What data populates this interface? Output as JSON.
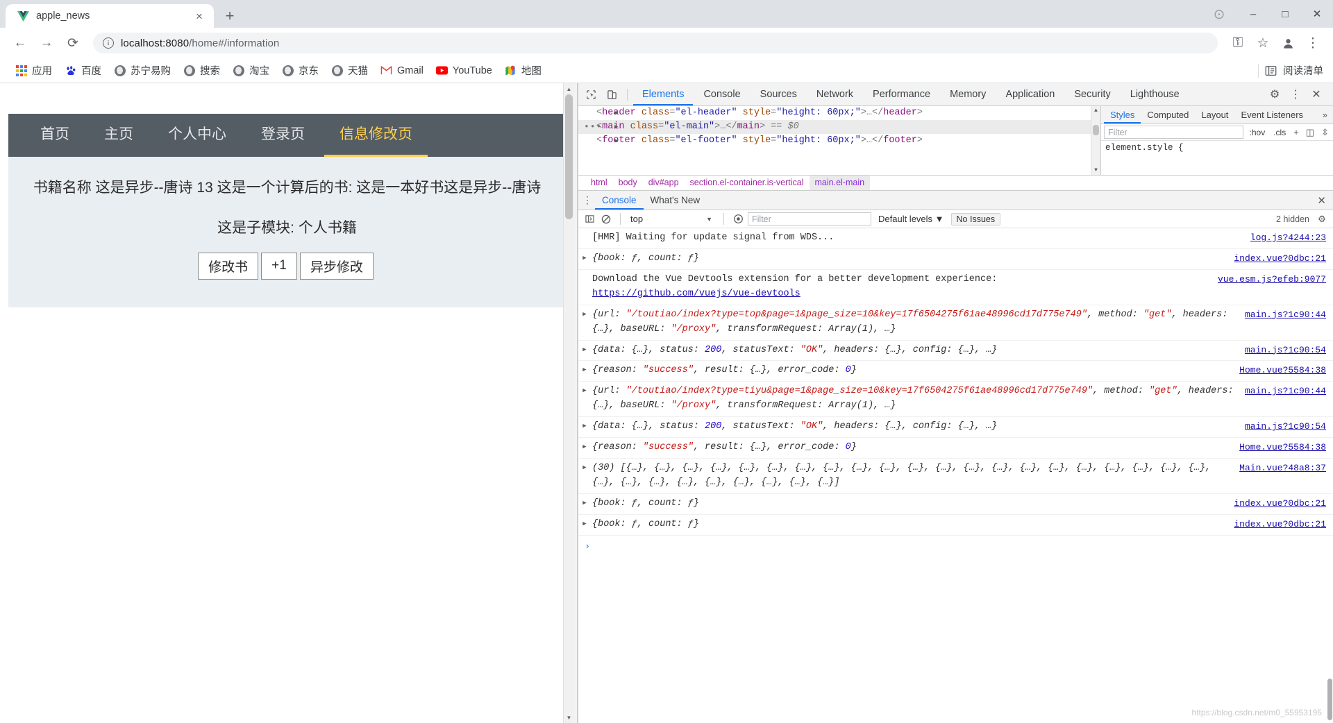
{
  "browser": {
    "tab": {
      "title": "apple_news",
      "favicon": "vue-logo-icon",
      "close": "×"
    },
    "new_tab": "+",
    "window_controls": {
      "minimize": "–",
      "maximize": "□",
      "close": "✕",
      "extra": "⊙"
    },
    "toolbar": {
      "back": "←",
      "forward": "→",
      "reload": "⟳",
      "url_secure_icon": "i",
      "url_host": "localhost:8080",
      "url_path": "/home#/information",
      "full_url": "localhost:8080/home#/information",
      "key_icon": "⚿",
      "star_icon": "☆",
      "profile_icon": "person-icon",
      "menu_icon": "⋮"
    },
    "bookmarks": [
      {
        "label": "应用",
        "icon": "apps-grid-icon"
      },
      {
        "label": "百度",
        "icon": "baidu-icon"
      },
      {
        "label": "苏宁易购",
        "icon": "globe-icon"
      },
      {
        "label": "搜索",
        "icon": "globe-icon"
      },
      {
        "label": "淘宝",
        "icon": "globe-icon"
      },
      {
        "label": "京东",
        "icon": "globe-icon"
      },
      {
        "label": "天猫",
        "icon": "globe-icon"
      },
      {
        "label": "Gmail",
        "icon": "gmail-icon"
      },
      {
        "label": "YouTube",
        "icon": "youtube-icon"
      },
      {
        "label": "地图",
        "icon": "maps-icon"
      }
    ],
    "reading_list": {
      "label": "阅读清单",
      "icon": "reading-list-icon"
    }
  },
  "app": {
    "nav": [
      {
        "label": "首页",
        "active": false
      },
      {
        "label": "主页",
        "active": false
      },
      {
        "label": "个人中心",
        "active": false
      },
      {
        "label": "登录页",
        "active": false
      },
      {
        "label": "信息修改页",
        "active": true
      }
    ],
    "book_line": "书籍名称 这是异步--唐诗 13 这是一个计算后的书: 这是一本好书这是异步--唐诗",
    "sub_line": "这是子模块: 个人书籍",
    "buttons": [
      {
        "label": "修改书"
      },
      {
        "label": "+1"
      },
      {
        "label": "异步修改"
      }
    ]
  },
  "devtools": {
    "tools": {
      "inspect": "inspect-icon",
      "device": "device-toolbar-icon"
    },
    "tabs": [
      {
        "label": "Elements",
        "active": true
      },
      {
        "label": "Console",
        "active": false
      },
      {
        "label": "Sources",
        "active": false
      },
      {
        "label": "Network",
        "active": false
      },
      {
        "label": "Performance",
        "active": false
      },
      {
        "label": "Memory",
        "active": false
      },
      {
        "label": "Application",
        "active": false
      },
      {
        "label": "Security",
        "active": false
      },
      {
        "label": "Lighthouse",
        "active": false
      }
    ],
    "tabbar_right": {
      "settings": "⚙",
      "kebab": "⋮",
      "close": "✕"
    },
    "dom": [
      {
        "indent": 1,
        "parts": [
          {
            "t": "<",
            "c": "gy"
          },
          {
            "t": "header",
            "c": "tg"
          },
          {
            "t": " class",
            "c": "at"
          },
          {
            "t": "=",
            "c": "gy"
          },
          {
            "t": "\"el-header\"",
            "c": "av"
          },
          {
            "t": " style",
            "c": "at"
          },
          {
            "t": "=",
            "c": "gy"
          },
          {
            "t": "\"height: 60px;\"",
            "c": "av"
          },
          {
            "t": ">…</",
            "c": "gy"
          },
          {
            "t": "header",
            "c": "tg"
          },
          {
            "t": ">",
            "c": "gy"
          }
        ],
        "selected": false,
        "dots": false
      },
      {
        "indent": 1,
        "parts": [
          {
            "t": "<",
            "c": "gy"
          },
          {
            "t": "main",
            "c": "tg"
          },
          {
            "t": " class",
            "c": "at"
          },
          {
            "t": "=",
            "c": "gy"
          },
          {
            "t": "\"el-main\"",
            "c": "av"
          },
          {
            "t": ">…</",
            "c": "gy"
          },
          {
            "t": "main",
            "c": "tg"
          },
          {
            "t": ">",
            "c": "gy"
          },
          {
            "t": " == $0",
            "c": "dollar"
          }
        ],
        "selected": true,
        "dots": true
      },
      {
        "indent": 1,
        "parts": [
          {
            "t": "<",
            "c": "gy"
          },
          {
            "t": "footer",
            "c": "tg"
          },
          {
            "t": " class",
            "c": "at"
          },
          {
            "t": "=",
            "c": "gy"
          },
          {
            "t": "\"el-footer\"",
            "c": "av"
          },
          {
            "t": " style",
            "c": "at"
          },
          {
            "t": "=",
            "c": "gy"
          },
          {
            "t": "\"height: 60px;\"",
            "c": "av"
          },
          {
            "t": ">…</",
            "c": "gy"
          },
          {
            "t": "footer",
            "c": "tg"
          },
          {
            "t": ">",
            "c": "gy"
          }
        ],
        "selected": false,
        "dots": false
      }
    ],
    "breadcrumb": [
      {
        "label": "html",
        "selected": false
      },
      {
        "label": "body",
        "selected": false
      },
      {
        "label": "div#app",
        "selected": false
      },
      {
        "label": "section.el-container.is-vertical",
        "selected": false
      },
      {
        "label": "main.el-main",
        "selected": true
      }
    ],
    "styles": {
      "tabs": [
        {
          "label": "Styles",
          "active": true
        },
        {
          "label": "Computed",
          "active": false
        },
        {
          "label": "Layout",
          "active": false
        },
        {
          "label": "Event Listeners",
          "active": false
        }
      ],
      "more": "»",
      "filter_placeholder": "Filter",
      "hov": ":hov",
      "cls": ".cls",
      "plus": "+",
      "layout_icons": [
        "◫",
        "⇳"
      ],
      "code": "element.style {"
    },
    "drawer": {
      "kebab": "⋮",
      "tabs": [
        {
          "label": "Console",
          "active": true
        },
        {
          "label": "What's New",
          "active": false
        }
      ],
      "close": "✕",
      "console_bar": {
        "sidebar_icon": "▣",
        "clear_icon": "⃠",
        "context": "top",
        "eye_icon": "◉",
        "filter_placeholder": "Filter",
        "levels": "Default levels",
        "issues": "No Issues",
        "hidden_count": "2 hidden",
        "settings_icon": "⚙"
      },
      "logs": [
        {
          "expandable": false,
          "segments": [
            {
              "t": "[HMR] Waiting for update signal from WDS...",
              "c": ""
            }
          ],
          "source": "log.js?4244:23"
        },
        {
          "expandable": true,
          "segments": [
            {
              "t": "{book: ƒ, count: ƒ}",
              "c": "it"
            }
          ],
          "source": "index.vue?0dbc:21"
        },
        {
          "expandable": false,
          "segments": [
            {
              "t": "Download the Vue Devtools extension for a better development experience:",
              "c": ""
            },
            {
              "t": "\n",
              "c": "br"
            },
            {
              "t": "https://github.com/vuejs/vue-devtools",
              "c": "lnk"
            }
          ],
          "source": "vue.esm.js?efeb:9077"
        },
        {
          "expandable": true,
          "segments": [
            {
              "t": "{url: ",
              "c": "it"
            },
            {
              "t": "\"/toutiao/index?type=top&page=1&page_size=10&key=17f6504275f61ae48996cd17d775e749\"",
              "c": "str it"
            },
            {
              "t": ", method: ",
              "c": "it"
            },
            {
              "t": "\"get\"",
              "c": "str it"
            },
            {
              "t": ", headers: {…}, baseURL: ",
              "c": "it"
            },
            {
              "t": "\"/proxy\"",
              "c": "str it"
            },
            {
              "t": ", transformRequest: Array(1), …}",
              "c": "it"
            }
          ],
          "source": "main.js?1c90:44"
        },
        {
          "expandable": true,
          "segments": [
            {
              "t": "{data: {…}, status: ",
              "c": "it"
            },
            {
              "t": "200",
              "c": "num it"
            },
            {
              "t": ", statusText: ",
              "c": "it"
            },
            {
              "t": "\"OK\"",
              "c": "str it"
            },
            {
              "t": ", headers: {…}, config: {…}, …}",
              "c": "it"
            }
          ],
          "source": "main.js?1c90:54"
        },
        {
          "expandable": true,
          "segments": [
            {
              "t": "{reason: ",
              "c": "it"
            },
            {
              "t": "\"success\"",
              "c": "str it"
            },
            {
              "t": ", result: {…}, error_code: ",
              "c": "it"
            },
            {
              "t": "0",
              "c": "num it"
            },
            {
              "t": "}",
              "c": "it"
            }
          ],
          "source": "Home.vue?5584:38"
        },
        {
          "expandable": true,
          "segments": [
            {
              "t": "{url: ",
              "c": "it"
            },
            {
              "t": "\"/toutiao/index?type=tiyu&page=1&page_size=10&key=17f6504275f61ae48996cd17d775e749\"",
              "c": "str it"
            },
            {
              "t": ", method: ",
              "c": "it"
            },
            {
              "t": "\"get\"",
              "c": "str it"
            },
            {
              "t": ", headers: {…}, baseURL: ",
              "c": "it"
            },
            {
              "t": "\"/proxy\"",
              "c": "str it"
            },
            {
              "t": ", transformRequest: Array(1), …}",
              "c": "it"
            }
          ],
          "source": "main.js?1c90:44"
        },
        {
          "expandable": true,
          "segments": [
            {
              "t": "{data: {…}, status: ",
              "c": "it"
            },
            {
              "t": "200",
              "c": "num it"
            },
            {
              "t": ", statusText: ",
              "c": "it"
            },
            {
              "t": "\"OK\"",
              "c": "str it"
            },
            {
              "t": ", headers: {…}, config: {…}, …}",
              "c": "it"
            }
          ],
          "source": "main.js?1c90:54"
        },
        {
          "expandable": true,
          "segments": [
            {
              "t": "{reason: ",
              "c": "it"
            },
            {
              "t": "\"success\"",
              "c": "str it"
            },
            {
              "t": ", result: {…}, error_code: ",
              "c": "it"
            },
            {
              "t": "0",
              "c": "num it"
            },
            {
              "t": "}",
              "c": "it"
            }
          ],
          "source": "Home.vue?5584:38"
        },
        {
          "expandable": true,
          "segments": [
            {
              "t": "(30) [{…}, {…}, {…}, {…}, {…}, {…}, {…}, {…}, {…}, {…}, {…}, {…}, {…}, {…}, {…}, {…}, {…}, {…}, {…}, {…}, {…}, {…}, {…}, {…}, {…}, {…}, {…}, {…}, {…}, {…}]",
              "c": "it"
            }
          ],
          "source": "Main.vue?48a8:37"
        },
        {
          "expandable": true,
          "segments": [
            {
              "t": "{book: ƒ, count: ƒ}",
              "c": "it"
            }
          ],
          "source": "index.vue?0dbc:21"
        },
        {
          "expandable": true,
          "segments": [
            {
              "t": "{book: ƒ, count: ƒ}",
              "c": "it"
            }
          ],
          "source": "index.vue?0dbc:21"
        }
      ],
      "prompt": "›"
    }
  },
  "watermark": "https://blog.csdn.net/m0_55953195",
  "colors": {
    "accent": "#1a73e8",
    "nav_bg": "#545c64",
    "nav_active": "#ffd04b",
    "main_bg": "#e9eef3",
    "chrome_tabstrip": "#dee1e6",
    "string": "#c41a16",
    "number": "#1c00cf"
  }
}
